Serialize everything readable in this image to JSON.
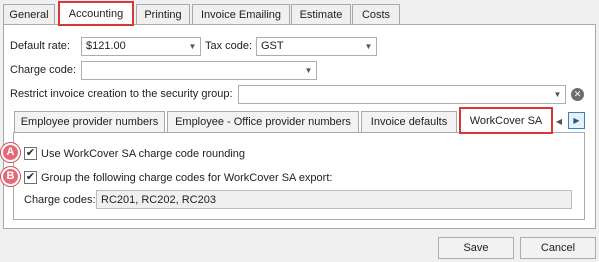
{
  "top_tabs": [
    {
      "label": "General"
    },
    {
      "label": "Accounting"
    },
    {
      "label": "Printing"
    },
    {
      "label": "Invoice Emailing"
    },
    {
      "label": "Estimate"
    },
    {
      "label": "Costs"
    }
  ],
  "form": {
    "default_rate_label": "Default rate:",
    "default_rate_value": "$121.00",
    "tax_code_label": "Tax code:",
    "tax_code_value": "GST",
    "charge_code_label": "Charge code:",
    "charge_code_value": "",
    "restrict_label": "Restrict invoice creation to the security group:",
    "restrict_value": ""
  },
  "inner_tabs": [
    {
      "label": "Employee provider numbers"
    },
    {
      "label": "Employee - Office provider numbers"
    },
    {
      "label": "Invoice defaults"
    },
    {
      "label": "WorkCover SA"
    }
  ],
  "workcover": {
    "checkbox_a_label": "Use WorkCover SA charge code rounding",
    "checkbox_a_checked": true,
    "checkbox_b_label": "Group the following charge codes for WorkCover SA export:",
    "checkbox_b_checked": true,
    "charge_codes_label": "Charge codes:",
    "charge_codes_value": "RC201, RC202, RC203"
  },
  "markers": {
    "a": "A",
    "b": "B"
  },
  "icons": {
    "checkmark": "✔",
    "dropdown": "▼",
    "clear": "✕",
    "scroll_left": "◀",
    "scroll_right": "▶"
  },
  "buttons": {
    "save_label": "Save",
    "cancel_label": "Cancel"
  },
  "colors": {
    "highlight": "#d8373a",
    "marker": "#e26a78"
  }
}
